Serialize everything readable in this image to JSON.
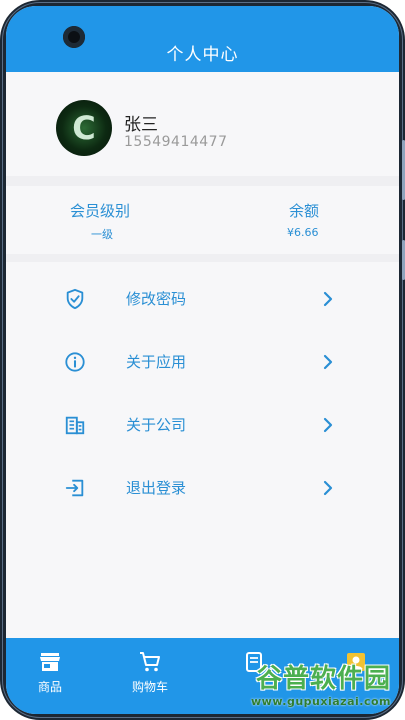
{
  "header": {
    "title": "个人中心"
  },
  "profile": {
    "avatar_letter": "C",
    "name": "张三",
    "phone": "15549414477"
  },
  "stats": {
    "level_label": "会员级别",
    "level_value": "一级",
    "balance_label": "余额",
    "balance_value": "¥6.66"
  },
  "menu": {
    "items": [
      {
        "label": "修改密码",
        "icon": "shield-check-icon"
      },
      {
        "label": "关于应用",
        "icon": "info-icon"
      },
      {
        "label": "关于公司",
        "icon": "building-icon"
      },
      {
        "label": "退出登录",
        "icon": "logout-icon"
      }
    ]
  },
  "tabbar": {
    "tabs": [
      {
        "label": "商品",
        "icon": "store-icon"
      },
      {
        "label": "购物车",
        "icon": "cart-icon"
      },
      {
        "label": "",
        "icon": "order-icon"
      },
      {
        "label": "",
        "icon": "user-icon"
      }
    ]
  },
  "watermark": {
    "brand": "谷普软件园",
    "url": "www.gupuxiazai.com"
  },
  "colors": {
    "primary": "#2196e8",
    "accent_text": "#2a8fd4",
    "background": "#f7f7f9"
  }
}
